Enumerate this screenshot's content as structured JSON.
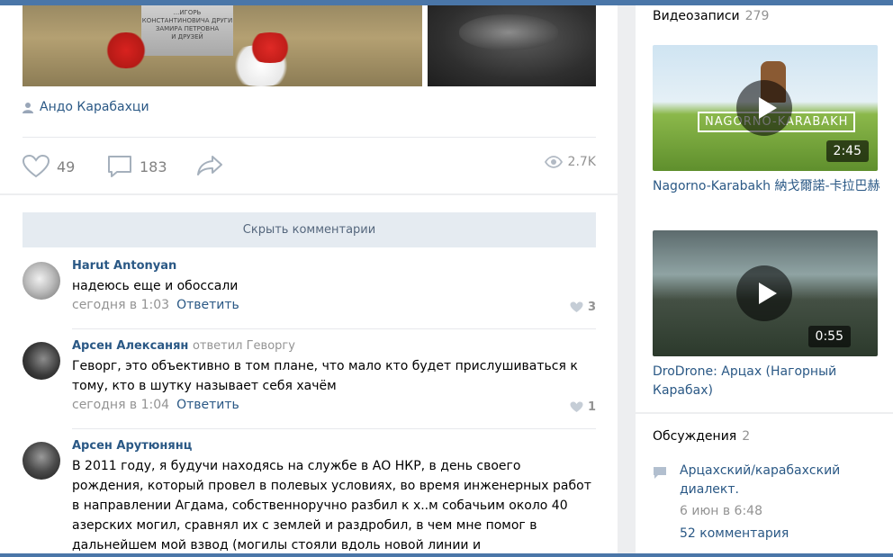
{
  "post": {
    "photo1_stone_text": "...ИГОРЬ КОНСТАНТИНОВИЧА ДРУГИ\nЗАМИРА ПЕТРОВНА\nИ ДРУЗЕЙ",
    "author": "Андо Карабахци",
    "likes": "49",
    "comments": "183",
    "views": "2.7K"
  },
  "comments_section": {
    "hide_label": "Скрыть комментарии",
    "reply_label": "Ответить",
    "items": [
      {
        "author": "Harut Antonyan",
        "replied": "",
        "text": "надеюсь еще и обоссали",
        "time": "сегодня в 1:03",
        "likes": "3"
      },
      {
        "author": "Арсен Алексанян",
        "replied": "ответил Геворгу",
        "text": "Геворг, это объективно в том плане, что мало кто будет прислушиваться к тому, кто в шутку называет себя хачём",
        "time": "сегодня в 1:04",
        "likes": "1"
      },
      {
        "author": "Арсен Арутюнянц",
        "replied": "",
        "text": "В 2011 году, я будучи находясь на службе в АО НКР, в день своего рождения, который провел в полевых условиях, во время инженерных работ в направлении Агдама, собственноручно разбил к х..м собачьим около 40 азерских могил, сравнял их с землей и раздробил, в чем мне помог в дальнейшем мой взвод (могилы стояли вдоль новой линии и",
        "time": "",
        "likes": ""
      }
    ]
  },
  "sidebar": {
    "videos_title": "Видеозаписи",
    "videos_count": "279",
    "videos": [
      {
        "caption": "NAGORNO-KARABAKH",
        "duration": "2:45",
        "title": "Nagorno-Karabakh 納戈爾諾-卡拉巴赫"
      },
      {
        "caption": "",
        "duration": "0:55",
        "title": "DroDrone: Арцах (Нагорный Карабах)"
      }
    ],
    "discussions_title": "Обсуждения",
    "discussions_count": "2",
    "discussion": {
      "topic": "Арцахский/карабахский диалект.",
      "date": "6 июн в 6:48",
      "comments": "52 комментария"
    }
  },
  "colors": {
    "accent": "#4a76a8",
    "link": "#2a5885",
    "muted": "#939393",
    "background": "#edeef0"
  }
}
